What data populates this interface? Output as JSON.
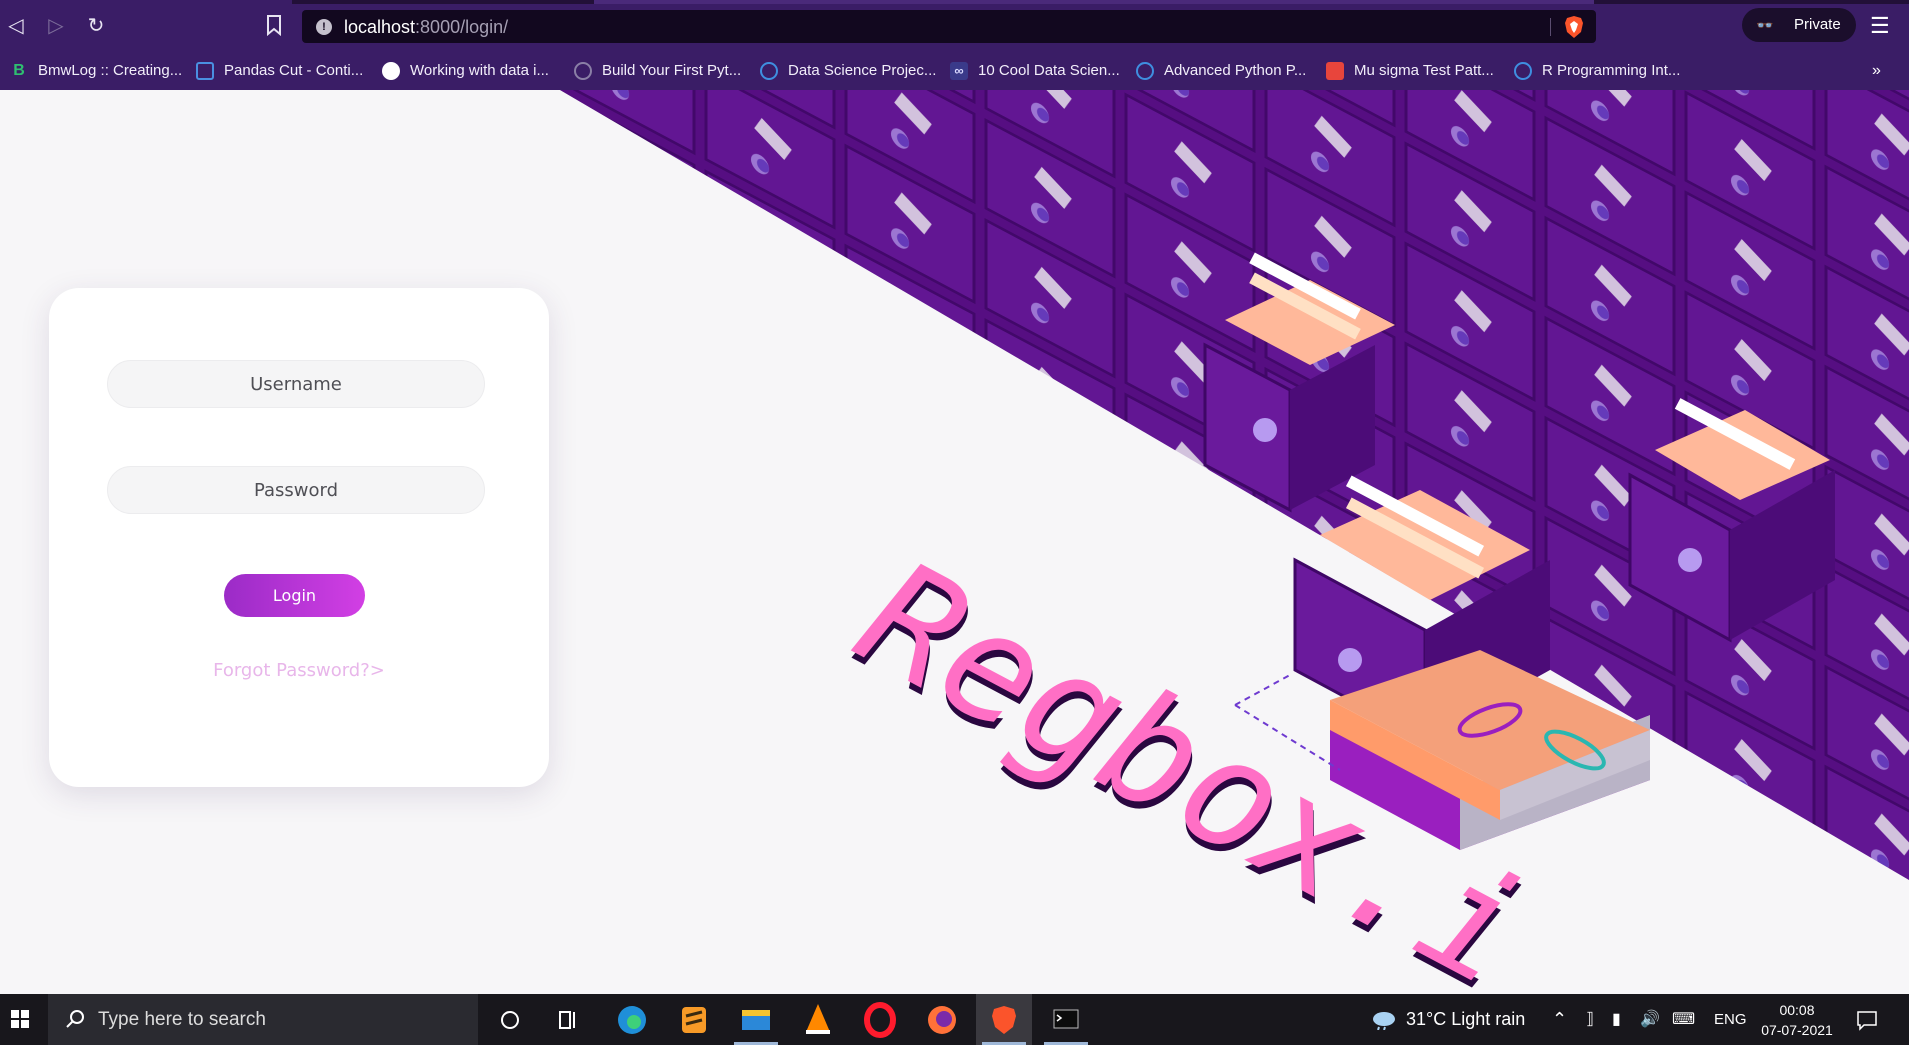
{
  "browser": {
    "url_host": "localhost",
    "url_path": ":8000/login/",
    "private_label": "Private",
    "bookmarks": [
      {
        "label": "BmwLog :: Creating...",
        "icon": "b-icon",
        "color": "#2fbf71"
      },
      {
        "label": "Pandas Cut - Conti...",
        "icon": "chart-icon",
        "color": "#4a90e2"
      },
      {
        "label": "Working with data i...",
        "icon": "globe-icon",
        "color": "#ffffff"
      },
      {
        "label": "Build Your First Pyt...",
        "icon": "hex-icon",
        "color": "#8a7fa6"
      },
      {
        "label": "Data Science Projec...",
        "icon": "ring-icon",
        "color": "#3f8fe0"
      },
      {
        "label": "10 Cool Data Scien...",
        "icon": "infinity-icon",
        "color": "#d8d8ff"
      },
      {
        "label": "Advanced Python P...",
        "icon": "ring-icon",
        "color": "#3f8fe0"
      },
      {
        "label": "Mu sigma Test Patt...",
        "icon": "flag-icon",
        "color": "#e8453c"
      },
      {
        "label": "R Programming Int...",
        "icon": "ring-icon",
        "color": "#3f8fe0"
      }
    ]
  },
  "login": {
    "username_placeholder": "Username",
    "password_placeholder": "Password",
    "login_label": "Login",
    "forgot_label": "Forgot Password?>"
  },
  "brand": {
    "wordmark": "Regbox.i"
  },
  "taskbar": {
    "search_placeholder": "Type here to search",
    "weather": "31°C  Light rain",
    "language": "ENG",
    "time": "00:08",
    "date": "07-07-2021"
  },
  "colors": {
    "accent_purple": "#6a0d9a",
    "button_gradient_start": "#9b2bc7",
    "button_gradient_end": "#d23fe4",
    "forgot_link": "#e8b6ea",
    "wordmark_pink": "#ff6fc5"
  }
}
